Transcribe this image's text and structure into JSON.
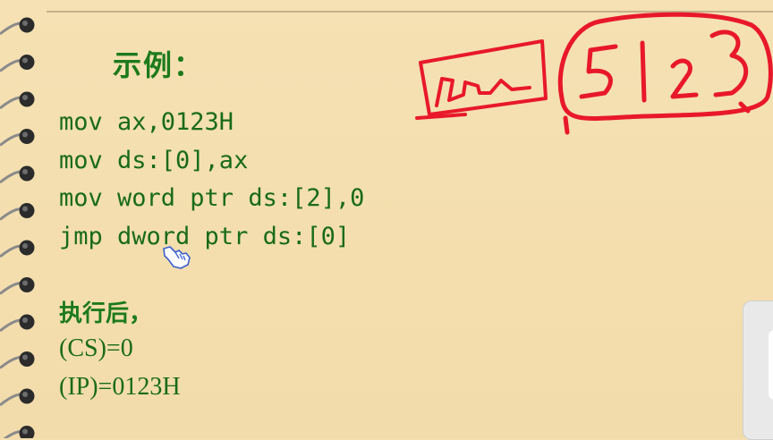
{
  "heading": "示例：",
  "code_lines": [
    "mov ax,0123H",
    "mov ds:[0],ax",
    "mov word ptr ds:[2],0",
    "jmp dword ptr ds:[0]"
  ],
  "after_label": "执行后，",
  "results": [
    "(CS)=0",
    "(IP)=0123H"
  ],
  "colors": {
    "paper": "#f4dfb0",
    "text_green": "#1c7a1c",
    "annotation_red": "#e8182a",
    "ring_dark": "#2b2b2b"
  },
  "icons": [
    "spiral-binding-ring-icon",
    "hand-pointer-cursor-icon"
  ]
}
